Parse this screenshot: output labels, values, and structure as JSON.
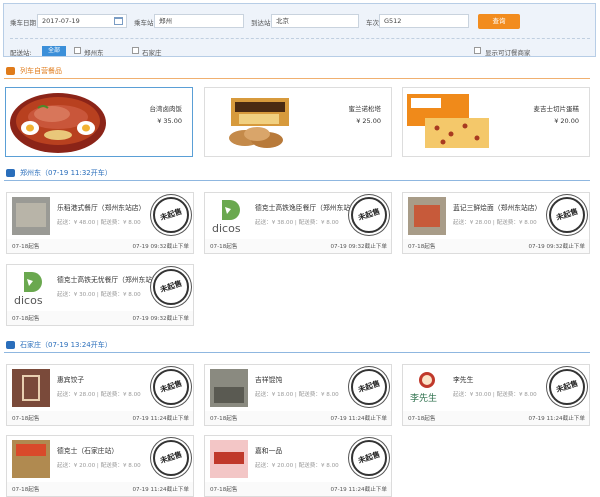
{
  "search": {
    "date_label": "乘车日期",
    "date_value": "2017-07-19",
    "board_label": "乘车站",
    "board_value": "郑州",
    "arrive_label": "到达站",
    "arrive_value": "北京",
    "train_label": "车次",
    "train_value": "G512",
    "query_button": "查询",
    "delivery_label": "配送站:",
    "all_button": "全部",
    "station_options": [
      "郑州东",
      "石家庄"
    ],
    "show_available_label": "显示可订餐商家"
  },
  "sections": {
    "train_food_title": "列车自营餐品",
    "zhengzhou_title": "郑州东（07-19 11:32开车）",
    "shijiazhuang_title": "石家庄（07-19 13:24开车）"
  },
  "foods": [
    {
      "name": "台湾卤肉饭",
      "price": "¥ 35.00"
    },
    {
      "name": "蜜兰诺松塔",
      "price": "¥ 25.00"
    },
    {
      "name": "麦吉士切片蛋糕",
      "price": "¥ 20.00"
    }
  ],
  "zhengzhou_restaurants": [
    {
      "name": "乐稻港式餐厅（郑州东站店）",
      "meta": "起送：¥ 48.00 | 配送费：¥ 8.00",
      "open": "07-18起售",
      "close": "07-19 09:32截止下单",
      "stamp": "未起售"
    },
    {
      "name": "德克士高铁逸臣餐厅（郑州东站）",
      "meta": "起送：¥ 38.00 | 配送费：¥ 8.00",
      "open": "07-18起售",
      "close": "07-19 09:32截止下单",
      "stamp": "未起售",
      "logo": "dicos"
    },
    {
      "name": "蓝记三鲜烩面（郑州东站店）",
      "meta": "起送：¥ 28.00 | 配送费：¥ 8.00",
      "open": "07-18起售",
      "close": "07-19 09:32截止下单",
      "stamp": "未起售"
    },
    {
      "name": "德克士高铁无忧餐厅（郑州东站）",
      "meta": "起送：¥ 30.00 | 配送费：¥ 8.00",
      "open": "07-18起售",
      "close": "07-19 09:32截止下单",
      "stamp": "未起售",
      "logo": "dicos"
    }
  ],
  "shijiazhuang_restaurants": [
    {
      "name": "惠宾饺子",
      "meta": "起送：¥ 28.00 | 配送费：¥ 8.00",
      "open": "07-18起售",
      "close": "07-19 11:24截止下单",
      "stamp": "未起售"
    },
    {
      "name": "吉祥馄饨",
      "meta": "起送：¥ 18.00 | 配送费：¥ 8.00",
      "open": "07-18起售",
      "close": "07-19 11:24截止下单",
      "stamp": "未起售"
    },
    {
      "name": "李先生",
      "meta": "起送：¥ 30.00 | 配送费：¥ 8.00",
      "open": "07-18起售",
      "close": "07-19 11:24截止下单",
      "stamp": "未起售",
      "logo": "李先生"
    },
    {
      "name": "德克士（石家庄站）",
      "meta": "起送：¥ 20.00 | 配送费：¥ 8.00",
      "open": "07-18起售",
      "close": "07-19 11:24截止下单",
      "stamp": "未起售"
    },
    {
      "name": "嘉和一品",
      "meta": "起送：¥ 20.00 | 配送费：¥ 8.00",
      "open": "07-18起售",
      "close": "07-19 11:24截止下单",
      "stamp": "未起售"
    }
  ],
  "colors": {
    "accent": "#f28c1e",
    "section_blue": "#2a6ebb",
    "section_orange": "#e07b1a",
    "dicos_green": "#6aa84f"
  }
}
